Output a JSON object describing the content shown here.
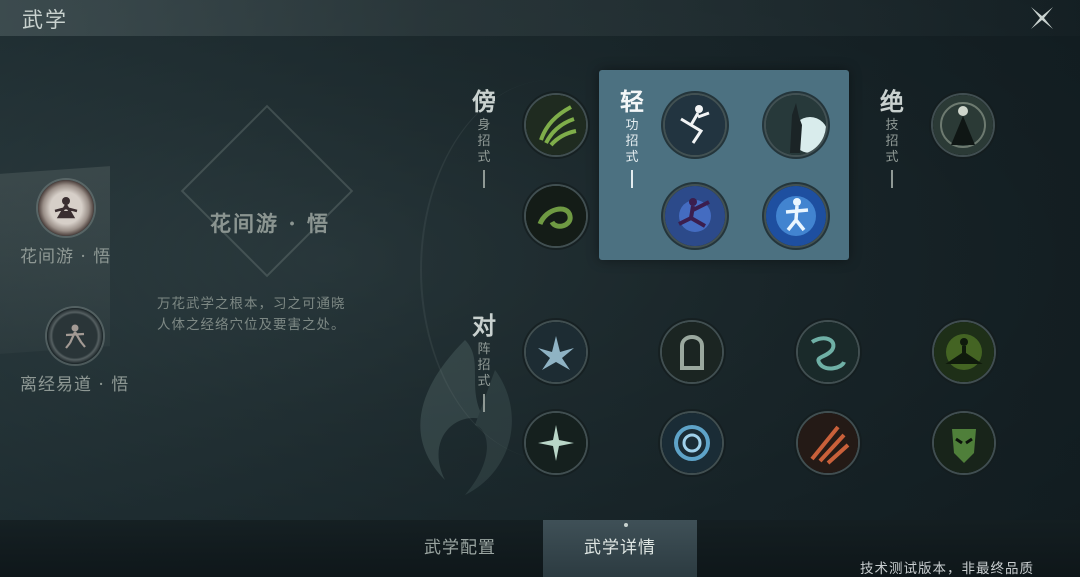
{
  "header": {
    "title": "武学"
  },
  "left_skills": [
    {
      "name": "花间游 · 悟",
      "icon": "figure-meditate-icon",
      "active": true
    },
    {
      "name": "离经易道 · 悟",
      "icon": "figure-dance-icon",
      "active": false
    }
  ],
  "detail": {
    "title": "花间游 · 悟",
    "description_line1": "万花武学之根本，习之可通晓",
    "description_line2": "人体之经络穴位及要害之处。"
  },
  "categories": {
    "shen": {
      "big": "傍",
      "small": "身招式"
    },
    "qing": {
      "big": "轻",
      "small": "功招式"
    },
    "jue": {
      "big": "绝",
      "small": "技招式"
    },
    "dui": {
      "big": "对",
      "small": "阵招式"
    }
  },
  "skill_icons": {
    "shen": [
      "green-claw-icon",
      "green-swirl-icon"
    ],
    "qing": [
      "leaping-figure-icon",
      "raised-hand-icon",
      "purple-kick-icon",
      "blue-glow-figure-icon"
    ],
    "jue": [
      "robed-master-icon"
    ],
    "dui_row1": [
      "lotus-burst-icon",
      "stone-shield-icon",
      "water-dragon-icon",
      "meditating-figure-icon"
    ],
    "dui_row2": [
      "star-burst-icon",
      "blue-vortex-icon",
      "fire-slash-icon",
      "green-mask-icon"
    ]
  },
  "tabs": {
    "config": "武学配置",
    "detail": "武学详情"
  },
  "footer": {
    "version_note": "技术测试版本，非最终品质"
  },
  "colors": {
    "highlight": "#4c7181",
    "background": "#1d2b2f",
    "text_muted": "#8e9894"
  }
}
